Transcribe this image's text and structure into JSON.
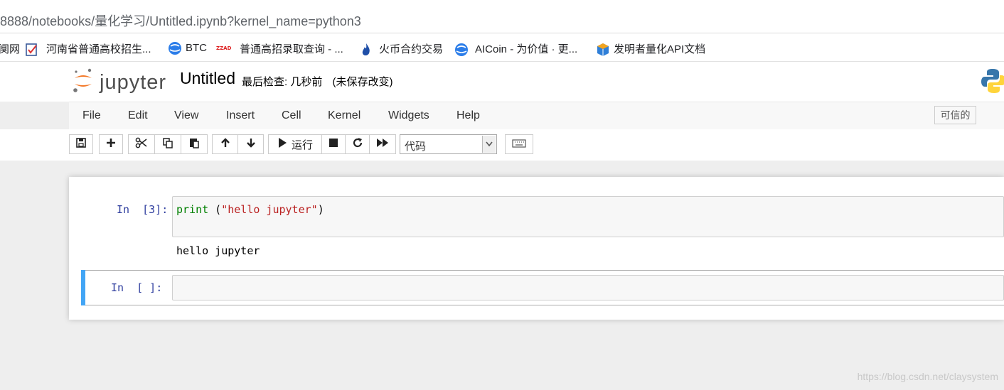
{
  "browser": {
    "url": "8888/notebooks/量化学习/Untitled.ipynb?kernel_name=python3",
    "bookmarks": [
      {
        "label": "阒网",
        "icon": "site-icon"
      },
      {
        "label": "河南省普通高校招生...",
        "icon": "check-doc-icon"
      },
      {
        "label": "BTC",
        "icon": "globe-icon"
      },
      {
        "label": "普通高招录取查询 - ...",
        "icon": "red-site-icon"
      },
      {
        "label": "火币合约交易",
        "icon": "flame-icon"
      },
      {
        "label": "AICoin - 为价值 · 更...",
        "icon": "globe-icon"
      },
      {
        "label": "发明者量化API文档",
        "icon": "cube-icon"
      }
    ]
  },
  "jupyter": {
    "logo_text": "jupyter",
    "notebook_name": "Untitled",
    "checkpoint_label": "最后检查: 几秒前",
    "autosave_status": "(未保存改变)",
    "trusted": "可信的",
    "menu": [
      "File",
      "Edit",
      "View",
      "Insert",
      "Cell",
      "Kernel",
      "Widgets",
      "Help"
    ],
    "toolbar": {
      "run_label": "运行",
      "cell_type": "代码"
    }
  },
  "cells": [
    {
      "prompt": "In  [3]:",
      "code_keyword": "print",
      "code_open": " (",
      "code_string": "\"hello jupyter\"",
      "code_close": ")",
      "output": "hello jupyter"
    },
    {
      "prompt": "In  [ ]:",
      "code": ""
    }
  ],
  "watermark": "https://blog.csdn.net/claysystem",
  "colors": {
    "prompt": "#303f9f",
    "keyword": "#008000",
    "string": "#ba2121",
    "selected_cell_bar": "#42a5f5",
    "jupyter_orange": "#f37726"
  }
}
